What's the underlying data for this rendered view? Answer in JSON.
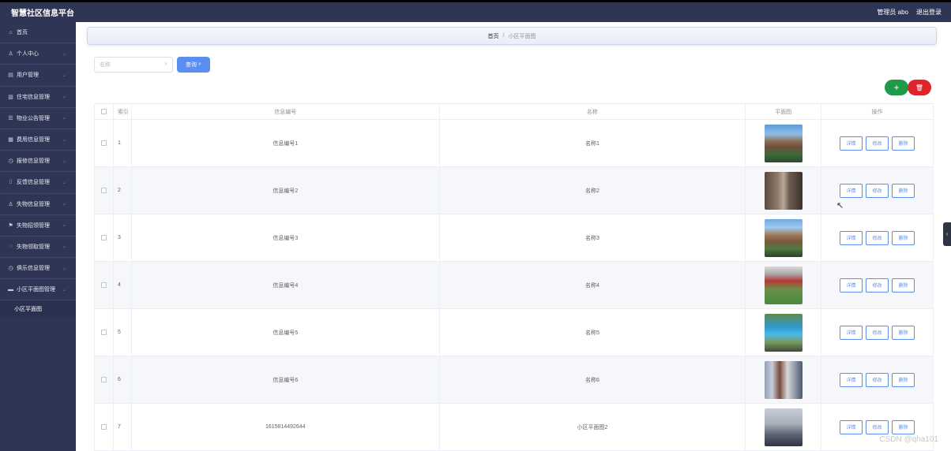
{
  "header": {
    "title": "智慧社区信息平台",
    "admin_label": "管理员 abo",
    "logout": "退出登录"
  },
  "sidebar": {
    "items": [
      {
        "icon": "⌂",
        "label": "首页",
        "has_chevron": false
      },
      {
        "icon": "♙",
        "label": "个人中心",
        "has_chevron": true
      },
      {
        "icon": "▤",
        "label": "用户管理",
        "has_chevron": true
      },
      {
        "icon": "▥",
        "label": "住宅信息管理",
        "has_chevron": true
      },
      {
        "icon": "☰",
        "label": "物业公告管理",
        "has_chevron": true
      },
      {
        "icon": "▦",
        "label": "费用信息管理",
        "has_chevron": true
      },
      {
        "icon": "◷",
        "label": "报修信息管理",
        "has_chevron": true
      },
      {
        "icon": "⁞⁞",
        "label": "反馈信息管理",
        "has_chevron": true
      },
      {
        "icon": "♙",
        "label": "失物信息管理",
        "has_chevron": true
      },
      {
        "icon": "⚑",
        "label": "失物招领管理",
        "has_chevron": true
      },
      {
        "icon": "◌",
        "label": "失物领取管理",
        "has_chevron": true
      },
      {
        "icon": "◷",
        "label": "俱乐信息管理",
        "has_chevron": true
      },
      {
        "icon": "▬",
        "label": "小区平面图管理",
        "has_chevron": true
      }
    ],
    "sub_item": "小区平面图"
  },
  "breadcrumb": {
    "home": "首页",
    "separator": "/",
    "current": "小区平面图"
  },
  "search": {
    "placeholder": "名称",
    "button": "查询"
  },
  "actions": {
    "add": "+",
    "delete": "🗑"
  },
  "table": {
    "headers": {
      "index": "索引",
      "code": "信息编号",
      "name": "名称",
      "image": "平面图",
      "ops": "操作"
    },
    "ops": {
      "detail": "详情",
      "edit": "修改",
      "remove": "删除"
    },
    "rows": [
      {
        "index": "1",
        "code": "信息编号1",
        "name": "名称1"
      },
      {
        "index": "2",
        "code": "信息编号2",
        "name": "名称2"
      },
      {
        "index": "3",
        "code": "信息编号3",
        "name": "名称3"
      },
      {
        "index": "4",
        "code": "信息编号4",
        "name": "名称4"
      },
      {
        "index": "5",
        "code": "信息编号5",
        "name": "名称5"
      },
      {
        "index": "6",
        "code": "信息编号6",
        "name": "名称6"
      },
      {
        "index": "7",
        "code": "1615814492644",
        "name": "小区平面图2"
      }
    ]
  },
  "edge_tab": "‹",
  "watermark": "CSDN @qha101"
}
